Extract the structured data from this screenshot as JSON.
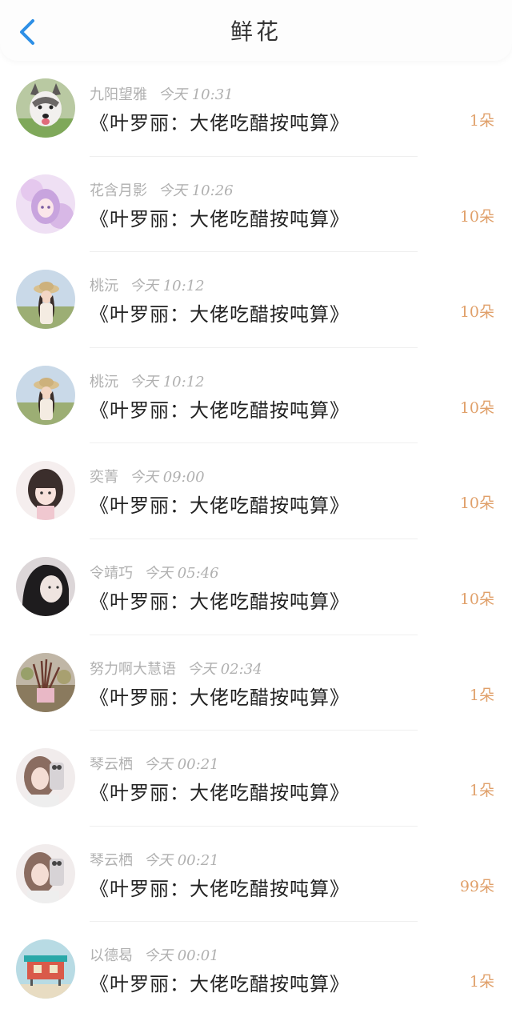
{
  "header": {
    "title": "鲜花",
    "accent": "#2e8fe6"
  },
  "amount_color": "#e0a06a",
  "rows": [
    {
      "user": "九阳望雅",
      "time": "今天 10:31",
      "book": "《叶罗丽：大佬吃醋按吨算》",
      "amount": "1朵",
      "avatar": "husky-dog-avatar"
    },
    {
      "user": "花含月影",
      "time": "今天 10:26",
      "book": "《叶罗丽：大佬吃醋按吨算》",
      "amount": "10朵",
      "avatar": "purple-anime-girl-avatar"
    },
    {
      "user": "桃沅",
      "time": "今天 10:12",
      "book": "《叶罗丽：大佬吃醋按吨算》",
      "amount": "10朵",
      "avatar": "girl-straw-hat-avatar"
    },
    {
      "user": "桃沅",
      "time": "今天 10:12",
      "book": "《叶罗丽：大佬吃醋按吨算》",
      "amount": "10朵",
      "avatar": "girl-straw-hat-avatar"
    },
    {
      "user": "奕菁",
      "time": "今天 09:00",
      "book": "《叶罗丽：大佬吃醋按吨算》",
      "amount": "10朵",
      "avatar": "girl-bangs-avatar"
    },
    {
      "user": "令靖巧",
      "time": "今天 05:46",
      "book": "《叶罗丽：大佬吃醋按吨算》",
      "amount": "10朵",
      "avatar": "dark-hair-girl-avatar"
    },
    {
      "user": "努力啊大慧语",
      "time": "今天 02:34",
      "book": "《叶罗丽：大佬吃醋按吨算》",
      "amount": "1朵",
      "avatar": "garden-plant-avatar"
    },
    {
      "user": "琴云栖",
      "time": "今天 00:21",
      "book": "《叶罗丽：大佬吃醋按吨算》",
      "amount": "1朵",
      "avatar": "girl-phone-selfie-avatar"
    },
    {
      "user": "琴云栖",
      "time": "今天 00:21",
      "book": "《叶罗丽：大佬吃醋按吨算》",
      "amount": "99朵",
      "avatar": "girl-phone-selfie-avatar"
    },
    {
      "user": "以德曷",
      "time": "今天 00:01",
      "book": "《叶罗丽：大佬吃醋按吨算》",
      "amount": "1朵",
      "avatar": "beach-hut-avatar"
    }
  ]
}
